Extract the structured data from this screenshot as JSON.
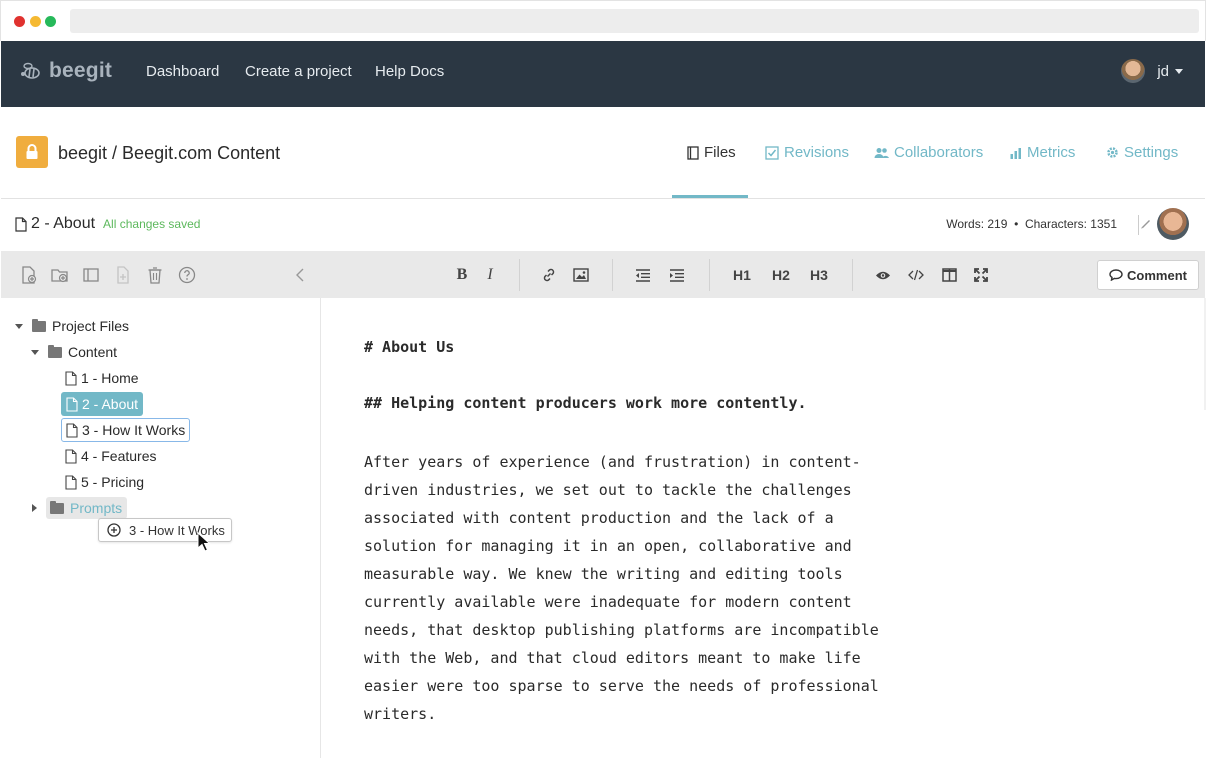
{
  "nav": {
    "brand": "beegit",
    "links": [
      "Dashboard",
      "Create a project",
      "Help Docs"
    ],
    "user": "jd"
  },
  "project": {
    "title": "beegit / Beegit.com Content",
    "tabs": [
      "Files",
      "Revisions",
      "Collaborators",
      "Metrics",
      "Settings"
    ],
    "active_tab": "Files"
  },
  "file": {
    "name": "2 - About",
    "status": "All changes saved",
    "stats": "Words: 219  •  Characters: 1351"
  },
  "tree": {
    "root": "Project Files",
    "folder": "Content",
    "files": [
      "1 - Home",
      "2 - About",
      "3 - How It Works",
      "4 - Features",
      "5 - Pricing"
    ],
    "collapsed_folder": "Prompts",
    "dragging": "3 - How It Works"
  },
  "toolbar": {
    "h1": "H1",
    "h2": "H2",
    "h3": "H3",
    "comment": "Comment",
    "bold": "B",
    "italic": "I"
  },
  "content": {
    "heading1": "# About Us",
    "heading2": "## Helping content producers work more contently.",
    "lines": [
      "After years of experience (and frustration) in content-",
      "driven industries, we set out to tackle the challenges",
      "associated with content production and the lack of a",
      "solution for managing it in an open, collaborative and",
      "measurable way. We knew the writing and editing tools",
      "currently available were inadequate for modern content",
      "needs, that desktop publishing platforms are incompatible",
      "with the Web, and that cloud editors meant to make life",
      "easier were too sparse to serve the needs of professional",
      "writers."
    ]
  },
  "colors": {
    "nav_bg": "#2b3743",
    "accent": "#72b8c7",
    "lock": "#f0ad3e",
    "saved": "#5cb85c"
  }
}
